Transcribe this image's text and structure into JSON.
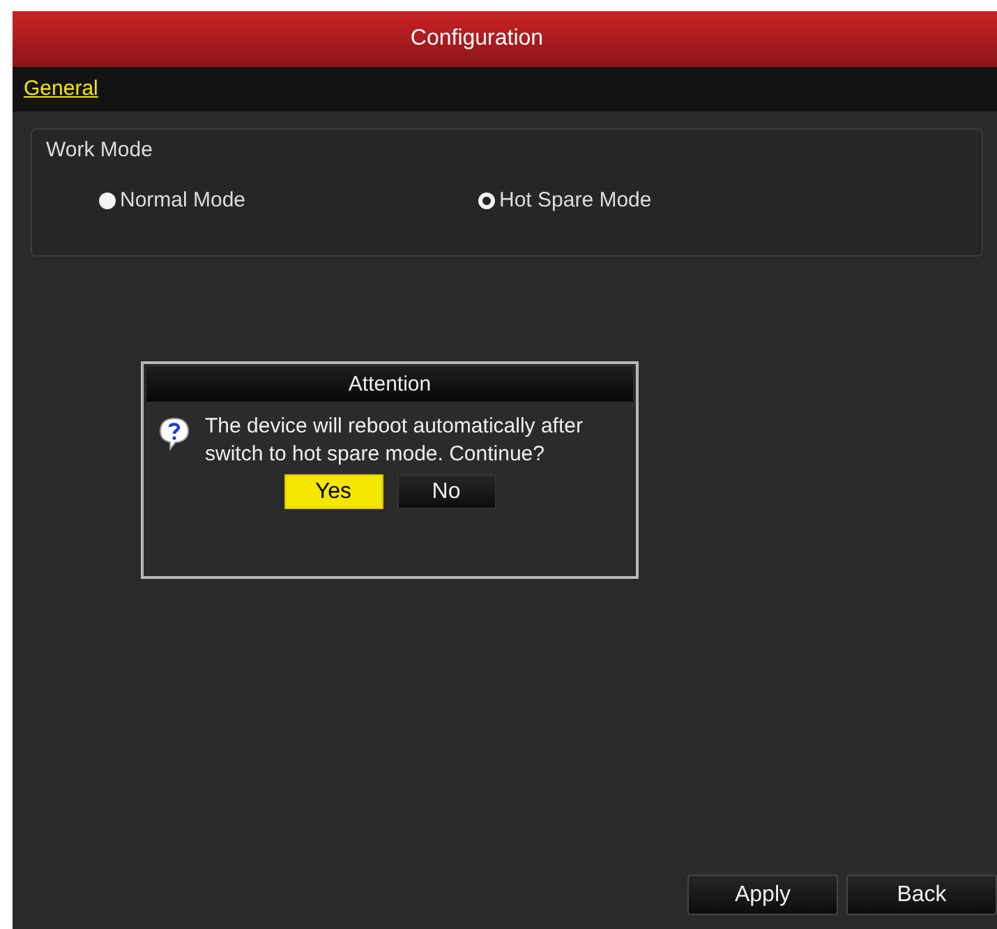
{
  "window": {
    "title": "Configuration"
  },
  "tabs": [
    {
      "label": "General",
      "selected": true
    }
  ],
  "work_mode": {
    "label": "Work Mode",
    "options": [
      {
        "label": "Normal Mode",
        "selected": false
      },
      {
        "label": "Hot Spare Mode",
        "selected": true
      }
    ]
  },
  "dialog": {
    "title": "Attention",
    "message": "The device will reboot automatically after switch to hot spare mode. Continue?",
    "buttons": [
      {
        "label": "Yes",
        "selected": true
      },
      {
        "label": "No",
        "selected": false
      }
    ]
  },
  "buttons": [
    "Apply",
    "Back"
  ]
}
